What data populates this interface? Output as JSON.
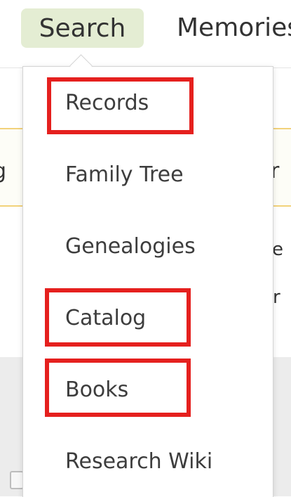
{
  "nav": {
    "items": [
      {
        "label": "Search",
        "active": true
      },
      {
        "label": "Memories"
      }
    ],
    "active_bg": "#e4edd3"
  },
  "background": {
    "left_fragment": "g",
    "right_fragment": "r",
    "right_fragment_2": "e",
    "right_fragment_3": "r"
  },
  "dropdown": {
    "items": [
      {
        "label": "Records",
        "highlighted": true
      },
      {
        "label": "Family Tree",
        "highlighted": false
      },
      {
        "label": "Genealogies",
        "highlighted": false
      },
      {
        "label": "Catalog",
        "highlighted": true
      },
      {
        "label": "Books",
        "highlighted": true
      },
      {
        "label": "Research Wiki",
        "highlighted": false
      }
    ]
  },
  "colors": {
    "highlight_border": "#e5201e",
    "menu_text": "#3d3d3d",
    "banner_border": "#f2d27a"
  }
}
